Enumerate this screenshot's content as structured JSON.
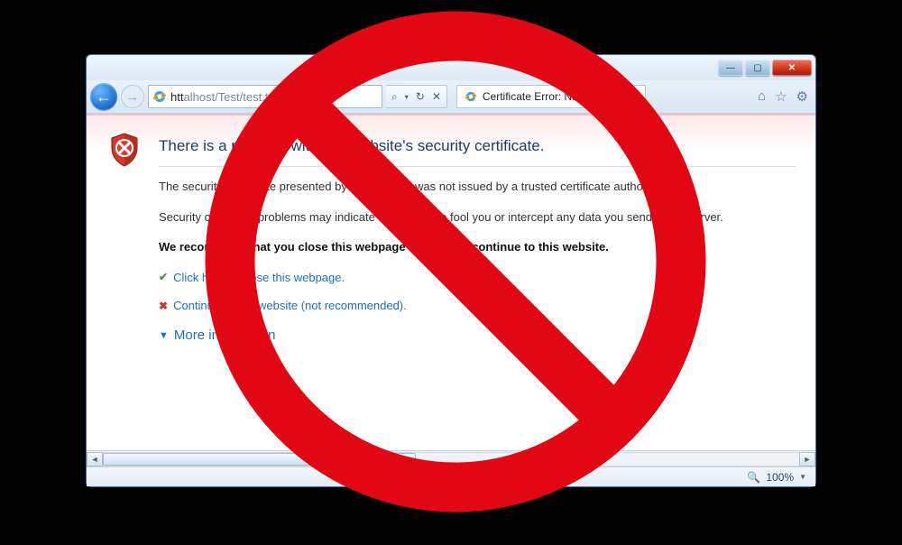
{
  "url": {
    "scheme": "htt",
    "rest": "alhost/Test/test.txt",
    "search_icon": "🔍"
  },
  "url_tools": {
    "search": "⌕",
    "sep": "▾",
    "refresh": "↻",
    "stop": "✕"
  },
  "tab": {
    "title": "Certificate Error: Navigation..."
  },
  "header_icons": {
    "home": "⌂",
    "star": "☆",
    "gear": "⚙"
  },
  "cert": {
    "title": "There is a problem with this website's security certificate.",
    "p1": "The security certificate presented by this website was not issued by a trusted certificate authority.",
    "p2": "Security certificate problems may indicate an attempt to fool you or intercept any data you send to the server.",
    "recommend": "We recommend that you close this webpage and do not continue to this website.",
    "close_link": "Click here to close this webpage.",
    "continue_link": "Continue to this website (not recommended).",
    "more": "More information"
  },
  "status": {
    "zoom": "100%"
  }
}
